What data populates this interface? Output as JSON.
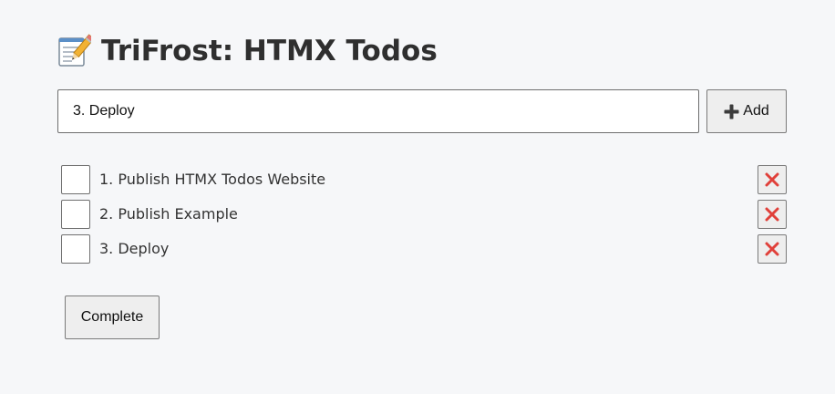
{
  "app": {
    "title": "TriFrost: HTMX Todos",
    "title_icon": "memo-icon"
  },
  "form": {
    "input_value": "3. Deploy",
    "add_label": "Add",
    "add_icon": "plus-icon"
  },
  "todos": [
    {
      "text": "1. Publish HTMX Todos Website",
      "checked": false,
      "delete_icon": "cross-mark-icon"
    },
    {
      "text": "2. Publish Example",
      "checked": false,
      "delete_icon": "cross-mark-icon"
    },
    {
      "text": "3. Deploy",
      "checked": false,
      "delete_icon": "cross-mark-icon"
    }
  ],
  "actions": {
    "complete_label": "Complete"
  },
  "colors": {
    "background": "#f6f7f9",
    "delete_icon": "#e0403a",
    "button_bg": "#eeeeee"
  }
}
